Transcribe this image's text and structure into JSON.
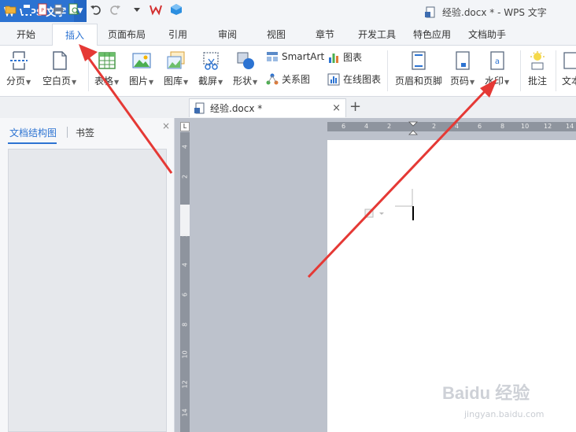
{
  "app": {
    "name": "WPS 文字",
    "window_title": "经验.docx * - WPS 文字"
  },
  "menu_tabs": [
    "开始",
    "插入",
    "页面布局",
    "引用",
    "审阅",
    "视图",
    "章节",
    "开发工具",
    "特色应用",
    "文档助手"
  ],
  "active_tab": "插入",
  "ribbon": {
    "page_break": "分页",
    "blank_page": "空白页",
    "table": "表格",
    "picture": "图片",
    "gallery": "图库",
    "screenshot": "截屏",
    "shape": "形状",
    "smartart": "SmartArt",
    "chart": "图表",
    "relation_chart": "关系图",
    "online_chart": "在线图表",
    "header_footer": "页眉和页脚",
    "page_number": "页码",
    "watermark": "水印",
    "comment": "批注",
    "textbox_partial": "文本"
  },
  "document_tab": {
    "name": "经验.docx *",
    "close": "×",
    "new_tab": "+"
  },
  "nav_pane": {
    "tab_outline": "文档结构图",
    "tab_bookmark": "书签",
    "close": "×"
  },
  "ruler": {
    "corner": "L",
    "horizontal_ticks": [
      "6",
      "4",
      "2",
      "2",
      "4",
      "6",
      "8",
      "10",
      "12",
      "14"
    ],
    "vertical_ticks": [
      "4",
      "2",
      "2",
      "4",
      "6",
      "8",
      "10",
      "12",
      "14"
    ]
  },
  "site_watermark": {
    "brand": "Baidu 经验",
    "url": "jingyan.baidu.com"
  },
  "colors": {
    "accent": "#2c73d2",
    "annotation_arrow": "#e53935"
  }
}
